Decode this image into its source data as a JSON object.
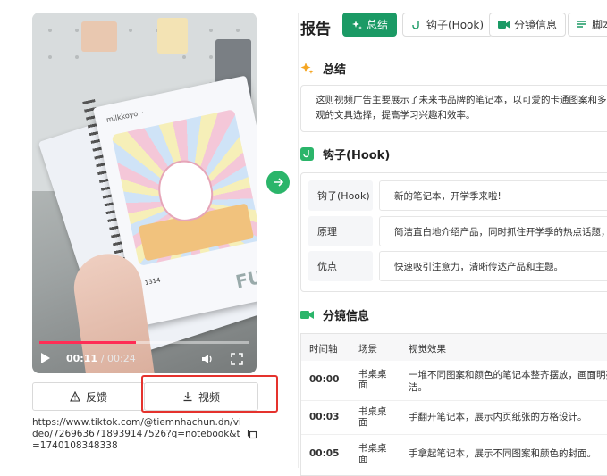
{
  "video": {
    "current_time": "00:11",
    "duration": "/ 00:24",
    "progress": 0.46,
    "handle_text": "milkkoyo~",
    "notebook_number": "1314",
    "notebook_fu": "FU"
  },
  "actions": {
    "feedback_label": "反馈",
    "video_label": "视频"
  },
  "source_url": "https://www.tiktok.com/@tiemnhachun.dn/video/7269636718939147526?q=notebook&t=1740108348338",
  "report": {
    "title": "报告",
    "tabs": [
      {
        "label": "总结",
        "icon": "sparkle-icon",
        "active": true
      },
      {
        "label": "钩子(Hook)",
        "icon": "hook-icon",
        "active": false
      },
      {
        "label": "分镜信息",
        "icon": "video-camera-icon",
        "active": false
      },
      {
        "label": "脚本",
        "icon": "script-icon",
        "active": false
      }
    ]
  },
  "summary": {
    "heading": "总结",
    "line1": "这则视频广告主要展示了未来书品牌的笔记本，以可爱的卡通图案和多",
    "line2": "观的文具选择，提高学习兴趣和效率。"
  },
  "hook": {
    "heading": "钩子(Hook)",
    "rows": [
      {
        "key": "钩子(Hook)",
        "value": "新的笔记本，开学季来啦!"
      },
      {
        "key": "原理",
        "value": "简洁直白地介绍产品，同时抓住开学季的热点话题，"
      },
      {
        "key": "优点",
        "value": "快速吸引注意力，清晰传达产品和主题。"
      }
    ]
  },
  "scenes": {
    "heading": "分镜信息",
    "columns": {
      "time": "时间轴",
      "scene": "场景",
      "effect": "视觉效果"
    },
    "rows": [
      {
        "time": "00:00",
        "scene": "书桌桌面",
        "effect": "一堆不同图案和颜色的笔记本整齐摆放，画面明亮整",
        "effect2": "洁。"
      },
      {
        "time": "00:03",
        "scene": "书桌桌面",
        "effect": "手翻开笔记本，展示内页纸张的方格设计。",
        "effect2": ""
      },
      {
        "time": "00:05",
        "scene": "书桌桌面",
        "effect": "手拿起笔记本，展示不同图案和颜色的封面。",
        "effect2": ""
      }
    ]
  },
  "colors": {
    "accent_green": "#1b9a65",
    "progress_red": "#ff2d55",
    "highlight_red": "#e5322d",
    "sparkle_orange": "#f5a623"
  }
}
